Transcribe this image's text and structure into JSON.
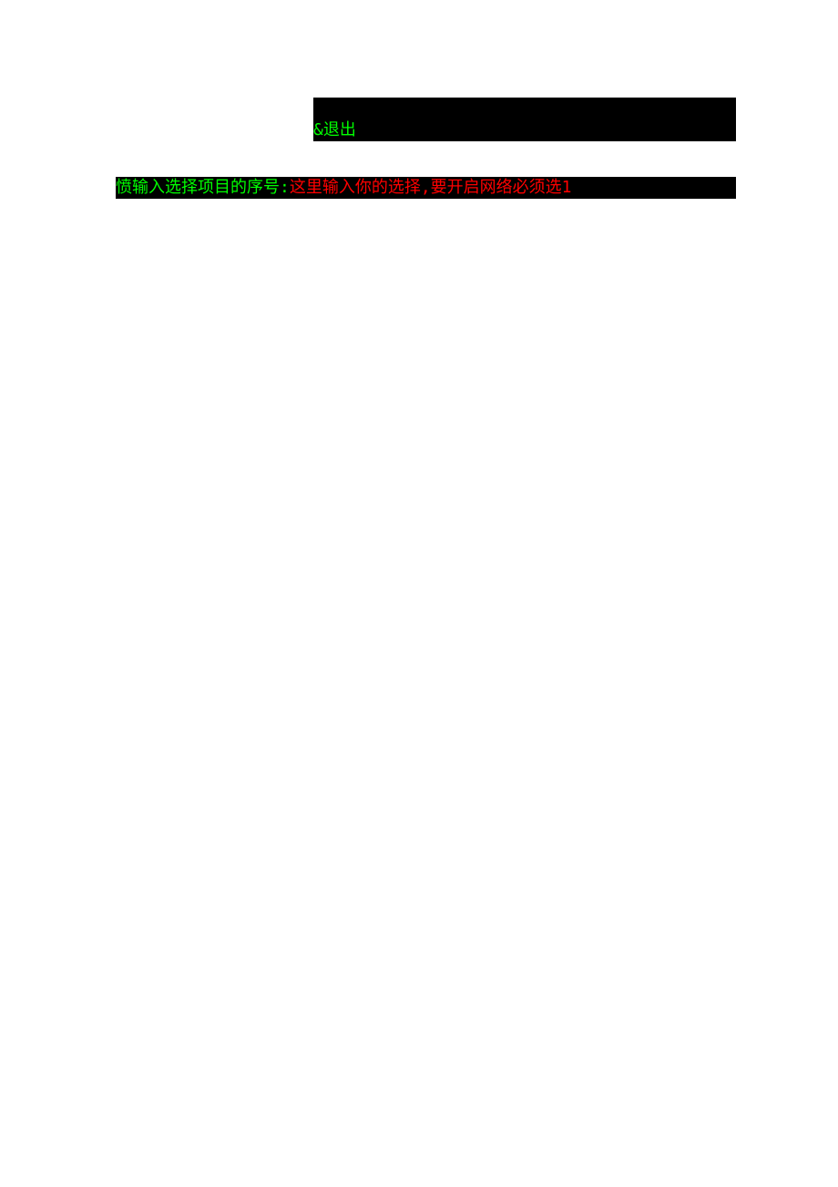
{
  "menu": {
    "exit_option": "&退出"
  },
  "prompt": {
    "label": "愤输入选择项目的序号:",
    "hint": "这里输入你的选择,要开启网络必须选1"
  }
}
